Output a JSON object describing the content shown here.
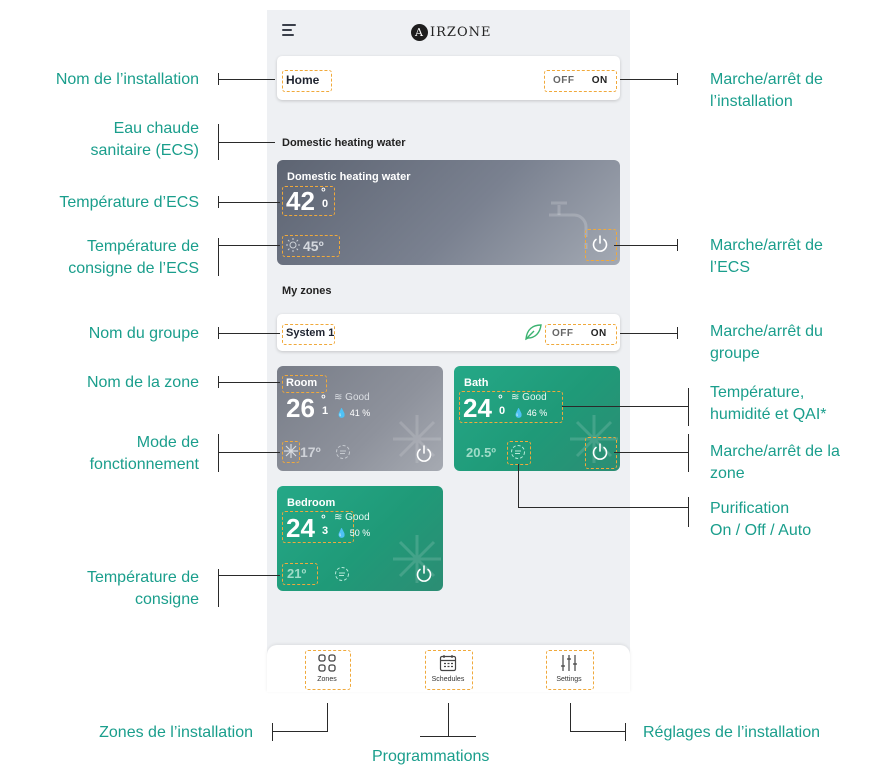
{
  "app": {
    "logo_letter": "A",
    "logo_text": "IRZONE"
  },
  "installation": {
    "name": "Home",
    "off": "OFF",
    "on": "ON"
  },
  "dhw_section": {
    "title": "Domestic heating water"
  },
  "dhw": {
    "name": "Domestic heating water",
    "temp_int": "42",
    "temp_deg": "°",
    "temp_dec": "0",
    "setpoint": "45º"
  },
  "zones_section": {
    "title": "My zones"
  },
  "group": {
    "name": "System 1",
    "off": "OFF",
    "on": "ON"
  },
  "zones": [
    {
      "name": "Room",
      "temp_int": "26",
      "temp_deg": "°",
      "temp_dec": "1",
      "iaq": "Good",
      "humidity": "41 %",
      "setpoint": "17º"
    },
    {
      "name": "Bath",
      "temp_int": "24",
      "temp_deg": "°",
      "temp_dec": "0",
      "iaq": "Good",
      "humidity": "46 %",
      "setpoint": "20.5º"
    },
    {
      "name": "Bedroom",
      "temp_int": "24",
      "temp_deg": "°",
      "temp_dec": "3",
      "iaq": "Good",
      "humidity": "50 %",
      "setpoint": "21º"
    }
  ],
  "nav": [
    {
      "label": "Zones"
    },
    {
      "label": "Schedules"
    },
    {
      "label": "Settings"
    }
  ],
  "annotations": {
    "installation_name": "Nom de l’installation",
    "dhw_line1": "Eau chaude",
    "dhw_line2": "sanitaire (ECS)",
    "dhw_temp": "Température d’ECS",
    "dhw_setpoint_line1": "Température de",
    "dhw_setpoint_line2": "consigne de l’ECS",
    "group_name": "Nom du groupe",
    "zone_name": "Nom de la zone",
    "mode_line1": "Mode de",
    "mode_line2": "fonctionnement",
    "setpoint_line1": "Température de",
    "setpoint_line2": "consigne",
    "zones_install": "Zones de l’installation",
    "programmations": "Programmations",
    "settings_install": "Réglages de l’installation",
    "install_onoff_line1": "Marche/arrêt de",
    "install_onoff_line2": "l’installation",
    "dhw_onoff_line1": "Marche/arrêt de",
    "dhw_onoff_line2": "l’ECS",
    "group_onoff_line1": "Marche/arrêt du",
    "group_onoff_line2": "groupe",
    "temp_hum_line1": "Température,",
    "temp_hum_line2": "humidité et QAI*",
    "zone_onoff_line1": "Marche/arrêt de la",
    "zone_onoff_line2": "zone",
    "purif_line1": "Purification",
    "purif_line2": "On / Off / Auto"
  },
  "colors": {
    "accent": "#1a9e8c",
    "highlight": "#f0a93b",
    "dhw_tile": "#7b8290",
    "zone_on": "#1f9a78",
    "zone_off": "#8b8f99"
  }
}
